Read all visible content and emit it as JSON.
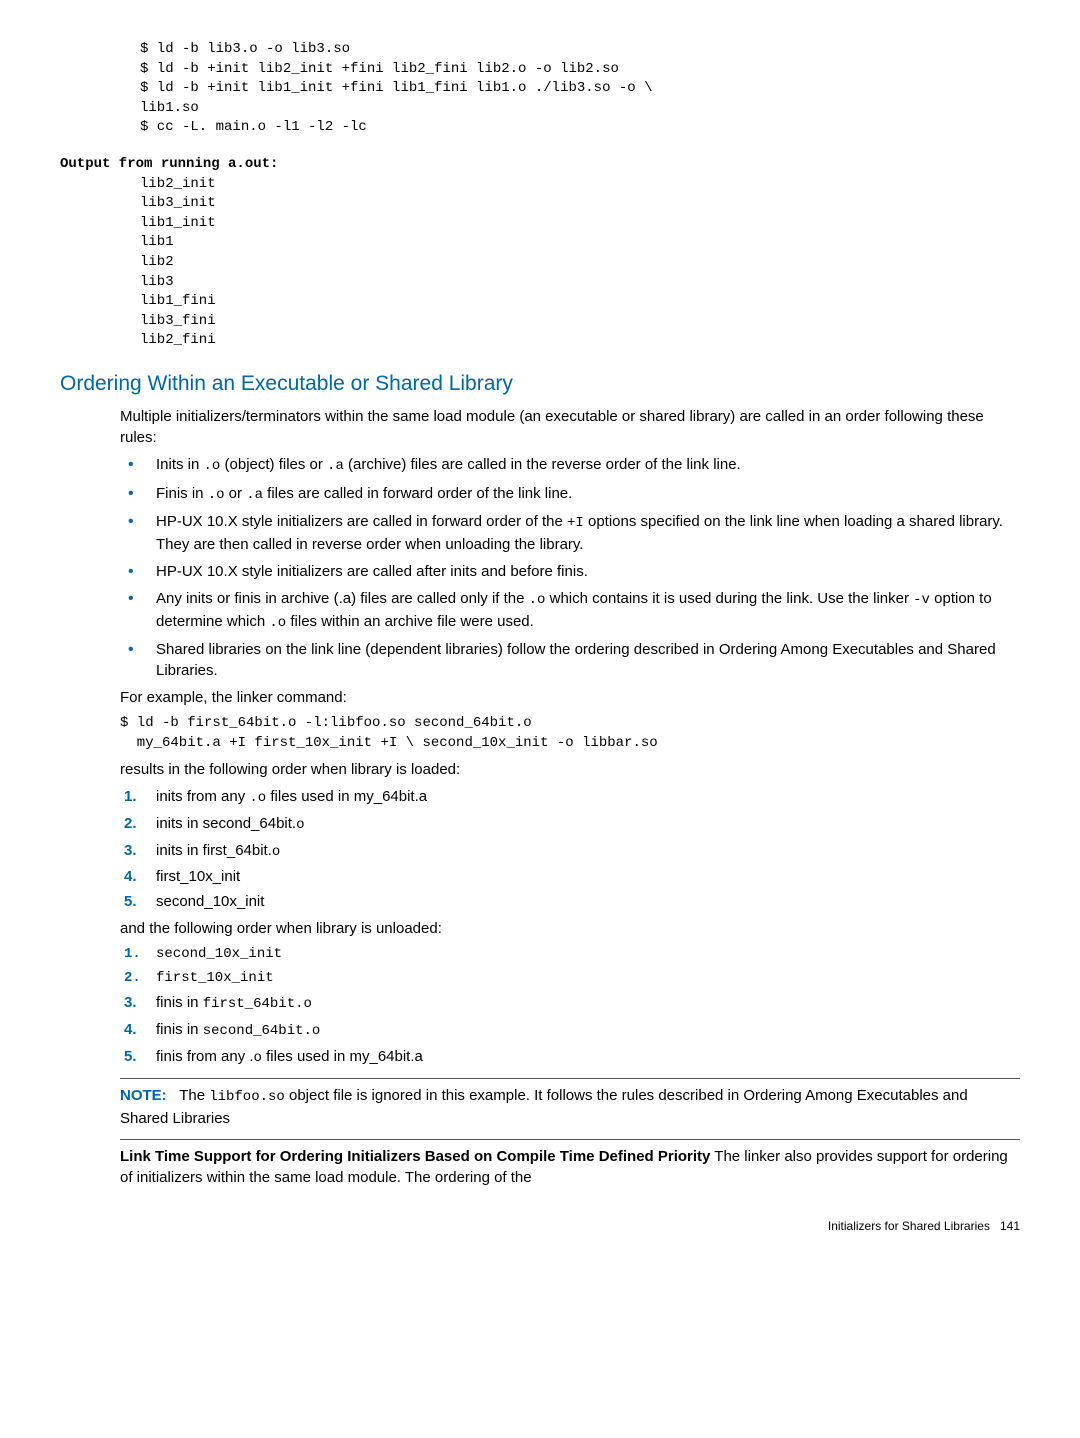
{
  "code1": "$ ld -b lib3.o -o lib3.so\n$ ld -b +init lib2_init +fini lib2_fini lib2.o -o lib2.so\n$ ld -b +init lib1_init +fini lib1_fini lib1.o ./lib3.so -o \\\nlib1.so\n$ cc -L. main.o -l1 -l2 -lc",
  "output_label": "Output from running a.out:",
  "output_block": "lib2_init\nlib3_init\nlib1_init\nlib1\nlib2\nlib3\nlib1_fini\nlib3_fini\nlib2_fini",
  "h2": "Ordering Within an Executable or Shared Library",
  "intro": "Multiple initializers/terminators within the same load module (an executable or shared library) are called in an order following these rules:",
  "bullets": [
    "Inits in .o (object) files or .a (archive) files are called in the reverse order of the link line.",
    "Finis in .o or .a files are called in forward order of the link line.",
    "HP-UX 10.X style initializers are called in forward order of the +I options specified on the link line when loading a shared library. They are then called in reverse order when unloading the library.",
    "HP-UX 10.X style initializers are called after inits and before finis.",
    "Any inits or finis in archive (.a) files are called only if the .o which contains it is used during the link. Use the linker -v option to determine which .o files within an archive file were used.",
    "Shared libraries on the link line (dependent libraries) follow the ordering described in Ordering Among Executables and Shared Libraries."
  ],
  "example_intro": "For example, the linker command:",
  "example_code": "$ ld -b first_64bit.o -l:libfoo.so second_64bit.o\n  my_64bit.a +I first_10x_init +I \\ second_10x_init -o libbar.so",
  "loaded_intro": "results in the following order when library is loaded:",
  "loaded_list": [
    "inits from any .o files used in my_64bit.a",
    "inits in second_64bit.o",
    "inits in first_64bit.o",
    "first_10x_init",
    "second_10x_init"
  ],
  "unloaded_intro": "and the following order when library is unloaded:",
  "unloaded_list": {
    "i1": "second_10x_init",
    "i2": "first_10x_init",
    "i3a": "finis in ",
    "i3b": "first_64bit.o",
    "i4a": "finis in ",
    "i4b": "second_64bit.o",
    "i5": "finis from any .o files used in my_64bit.a"
  },
  "note_label": "NOTE:",
  "note_pre": "The ",
  "note_code": "libfoo.so",
  "note_post": " object file is ignored in this example. It follows the rules described in Ordering Among Executables and Shared Libraries",
  "subhead": "Link Time Support for Ordering Initializers Based on Compile Time Defined Priority",
  "subhead_text": " The linker also provides support for ordering of initializers within the same load module. The ordering of the",
  "footer": "Initializers for Shared Libraries",
  "page": "141"
}
